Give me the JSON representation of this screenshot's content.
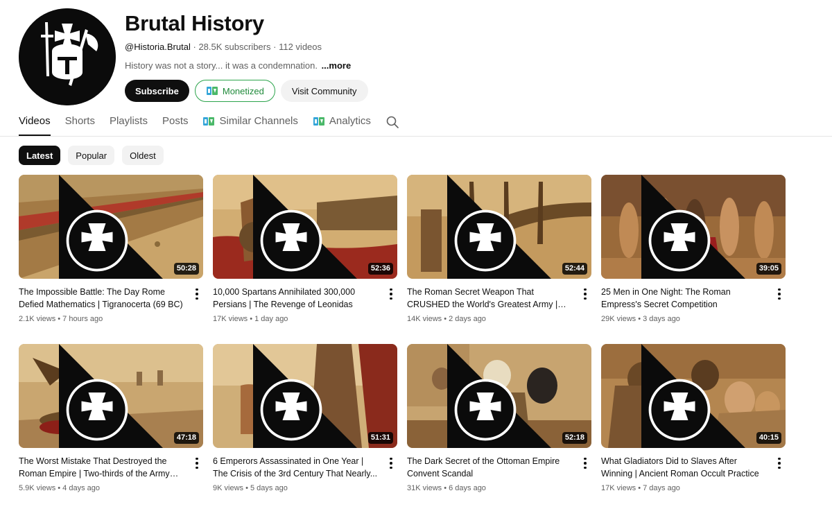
{
  "channel": {
    "title": "Brutal History",
    "handle": "@Historia.Brutal",
    "subscribers": "28.5K subscribers",
    "videos": "112 videos",
    "separator": "·",
    "description": "History was not a story... it was a condemnation.",
    "more": "...more"
  },
  "buttons": {
    "subscribe": "Subscribe",
    "monetized": "Monetized",
    "community": "Visit Community"
  },
  "tabs": [
    "Videos",
    "Shorts",
    "Playlists",
    "Posts",
    "Similar Channels",
    "Analytics"
  ],
  "chips": [
    "Latest",
    "Popular",
    "Oldest"
  ],
  "colors": {
    "accent_green": "#1f8a3a",
    "text": "#0f0f0f",
    "secondary": "#606060",
    "chip_bg": "#f2f2f2"
  },
  "icons": {
    "extension": "extension-logo-icon",
    "search": "search-icon",
    "menu": "more-vert-icon"
  },
  "videos": [
    {
      "title": "The Impossible Battle: The Day Rome Defied Mathematics | Tigranocerta (69 BC)",
      "duration": "50:28",
      "views": "2.1K views",
      "age": "7 hours ago"
    },
    {
      "title": "10,000 Spartans Annihilated 300,000 Persians | The Revenge of Leonidas",
      "duration": "52:36",
      "views": "17K views",
      "age": "1 day ago"
    },
    {
      "title": "The Roman Secret Weapon That CRUSHED the World's Greatest Army | Battle of...",
      "duration": "52:44",
      "views": "14K views",
      "age": "2 days ago"
    },
    {
      "title": "25 Men in One Night: The Roman Empress's Secret Competition",
      "duration": "39:05",
      "views": "29K views",
      "age": "3 days ago"
    },
    {
      "title": "The Worst Mistake That Destroyed the Roman Empire | Two-thirds of the Army Fall",
      "duration": "47:18",
      "views": "5.9K views",
      "age": "4 days ago"
    },
    {
      "title": "6 Emperors Assassinated in One Year | The Crisis of the 3rd Century That Nearly...",
      "duration": "51:31",
      "views": "9K views",
      "age": "5 days ago"
    },
    {
      "title": "The Dark Secret of the Ottoman Empire Convent Scandal",
      "duration": "52:18",
      "views": "31K views",
      "age": "6 days ago"
    },
    {
      "title": "What Gladiators Did to Slaves After Winning | Ancient Roman Occult Practice",
      "duration": "40:15",
      "views": "17K views",
      "age": "7 days ago"
    }
  ]
}
